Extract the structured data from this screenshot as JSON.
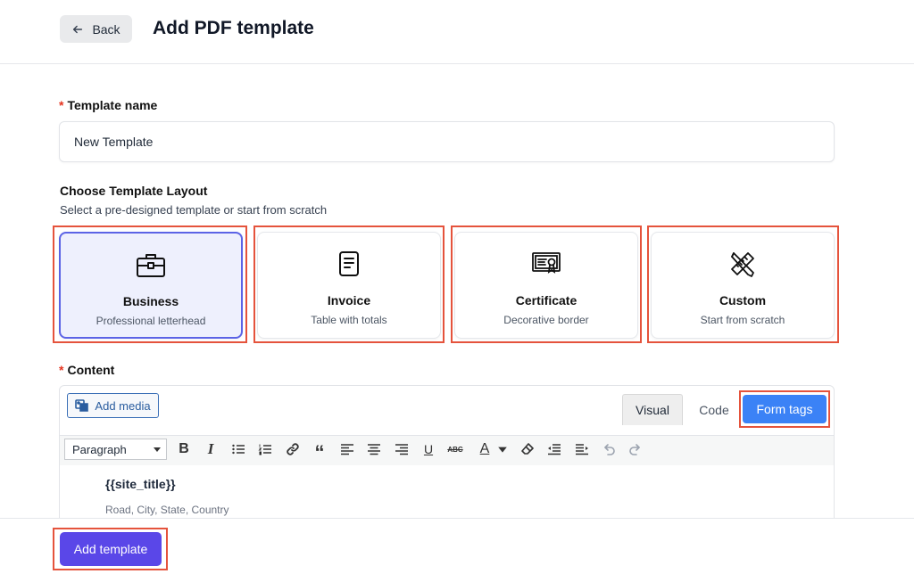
{
  "header": {
    "back_label": "Back",
    "title": "Add PDF template"
  },
  "form": {
    "required_mark": "*",
    "template_name_label": "Template name",
    "template_name_value": "New Template",
    "layout_label": "Choose Template Layout",
    "layout_subtext": "Select a pre-designed template or start from scratch",
    "content_label": "Content"
  },
  "layouts": [
    {
      "title": "Business",
      "desc": "Professional letterhead",
      "icon": "briefcase-icon",
      "selected": true
    },
    {
      "title": "Invoice",
      "desc": "Table with totals",
      "icon": "document-icon",
      "selected": false
    },
    {
      "title": "Certificate",
      "desc": "Decorative border",
      "icon": "certificate-icon",
      "selected": false
    },
    {
      "title": "Custom",
      "desc": "Start from scratch",
      "icon": "pencil-ruler-icon",
      "selected": false
    }
  ],
  "editor": {
    "add_media_label": "Add media",
    "tab_visual": "Visual",
    "tab_code": "Code",
    "form_tags_label": "Form tags",
    "format_value": "Paragraph",
    "site_title": "{{site_title}}",
    "address": "Road, City, State, Country"
  },
  "footer": {
    "add_button_label": "Add template"
  },
  "colors": {
    "accent": "#5a47e8",
    "selected_bg": "#eef0fd",
    "selected_border": "#5b63e6",
    "form_tags_bg": "#3b82f6",
    "highlight": "#e5533c",
    "required": "#e5341f"
  }
}
